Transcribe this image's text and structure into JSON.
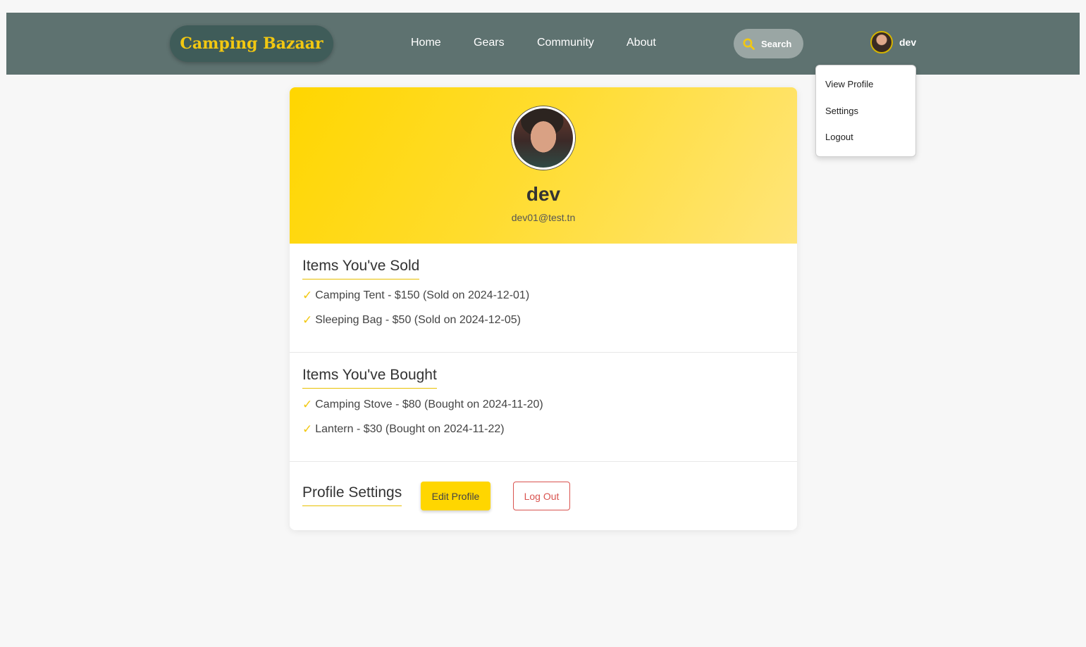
{
  "navbar": {
    "brand": "Camping Bazaar",
    "links": [
      "Home",
      "Gears",
      "Community",
      "About"
    ],
    "search_label": "Search",
    "user_name": "dev"
  },
  "dropdown": {
    "items": [
      "View Profile",
      "Settings",
      "Logout"
    ]
  },
  "profile": {
    "name": "dev",
    "email": "dev01@test.tn"
  },
  "sold": {
    "title": "Items You've Sold",
    "items": [
      "Camping Tent - $150 (Sold on 2024-12-01)",
      "Sleeping Bag - $50 (Sold on 2024-12-05)"
    ]
  },
  "bought": {
    "title": "Items You've Bought",
    "items": [
      "Camping Stove - $80 (Bought on 2024-11-20)",
      "Lantern - $30 (Bought on 2024-11-22)"
    ]
  },
  "settings": {
    "title": "Profile Settings",
    "edit_label": "Edit Profile",
    "logout_label": "Log Out"
  },
  "icons": {
    "check": "✓",
    "search": "search-icon"
  },
  "colors": {
    "navbar": "#5e7270",
    "brand_bg": "#3f5c59",
    "accent": "#ffd600",
    "danger": "#d9534f"
  }
}
